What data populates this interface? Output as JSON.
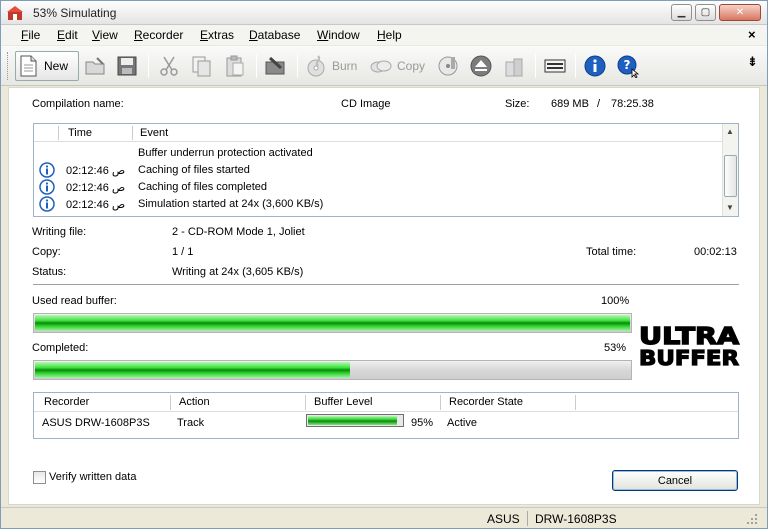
{
  "window": {
    "title": "53% Simulating"
  },
  "menu": [
    "File",
    "Edit",
    "View",
    "Recorder",
    "Extras",
    "Database",
    "Window",
    "Help"
  ],
  "toolbar": {
    "new_label": "New",
    "burn_label": "Burn",
    "copy_label": "Copy"
  },
  "compilation": {
    "name_label": "Compilation name:",
    "name_value": "CD Image",
    "size_label": "Size:",
    "size_mb": "689 MB",
    "size_sep": "/",
    "size_time": "78:25.38"
  },
  "log": {
    "col_time": "Time",
    "col_event": "Event",
    "rows": [
      {
        "time": "",
        "event": "Buffer underrun protection activated",
        "icon": ""
      },
      {
        "time": "02:12:46 ص",
        "event": "Caching of files started",
        "icon": "info-icon"
      },
      {
        "time": "02:12:46 ص",
        "event": "Caching of files completed",
        "icon": "info-icon"
      },
      {
        "time": "02:12:46 ص",
        "event": "Simulation started at 24x (3,600 KB/s)",
        "icon": "info-icon"
      }
    ]
  },
  "status": {
    "writing_file_label": "Writing file:",
    "writing_file_value": "2 - CD-ROM Mode 1, Joliet",
    "copy_label": "Copy:",
    "copy_value": "1 / 1",
    "total_time_label": "Total time:",
    "total_time_value": "00:02:13",
    "status_label": "Status:",
    "status_value": "Writing at 24x (3,605 KB/s)"
  },
  "buffer": {
    "label": "Used read buffer:",
    "percent_text": "100%",
    "fraction": 1.0
  },
  "completed": {
    "label": "Completed:",
    "percent_text": "53%",
    "fraction": 0.53
  },
  "logo_text": {
    "line1": "ULTRA",
    "line2": "BUFFER"
  },
  "recorder_table": {
    "headers": [
      "Recorder",
      "Action",
      "Buffer Level",
      "Recorder State"
    ],
    "row": {
      "recorder": "ASUS DRW-1608P3S",
      "action": "Track",
      "buffer_percent_text": "95%",
      "buffer_fraction": 0.95,
      "state": "Active"
    }
  },
  "verify_label": "Verify written data",
  "cancel_label": "Cancel",
  "statusbar": {
    "vendor": "ASUS",
    "model": "DRW-1608P3S"
  },
  "colors": {
    "progress_green": "#2fd42f",
    "title_close": "#d9765f"
  }
}
